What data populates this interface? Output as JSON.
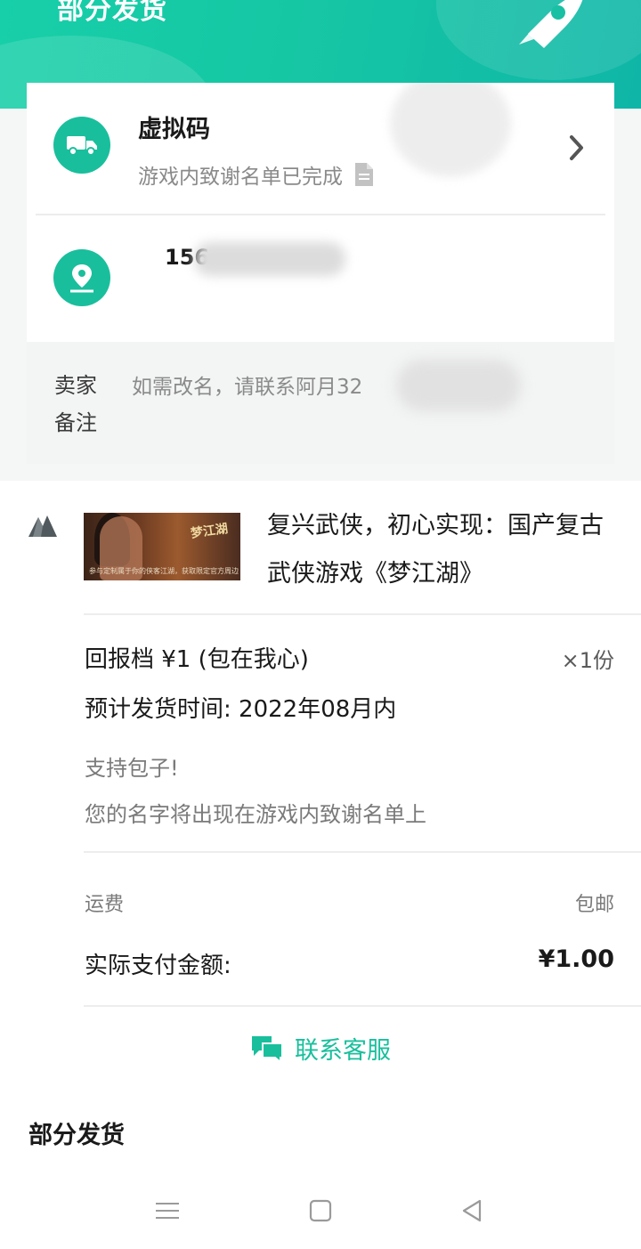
{
  "header": {
    "title": "部分发货"
  },
  "shipping": {
    "method_title": "虚拟码",
    "method_status": "游戏内致谢名单已完成"
  },
  "address": {
    "phone_prefix": "156"
  },
  "seller_note": {
    "label": "卖家备注",
    "text": "如需改名，请联系阿月32"
  },
  "product": {
    "title": "复兴武侠，初心实现：国产复古武侠游戏《梦江湖》",
    "image_logo": "梦江湖",
    "image_caption": "参与定制属于你的侠客江湖，获取限定官方周边",
    "tier": "回报档 ¥1 (包在我心)",
    "quantity": "×1份",
    "eta": "预计发货时间: 2022年08月内",
    "desc_line1": "支持包子!",
    "desc_line2": "您的名字将出现在游戏内致谢名单上"
  },
  "fees": {
    "shipping_label": "运费",
    "shipping_value": "包邮",
    "paid_label": "实际支付金额:",
    "paid_value": "¥1.00"
  },
  "contact": {
    "label": "联系客服"
  },
  "footer": {
    "status": "部分发货"
  },
  "colors": {
    "accent": "#19bf9c",
    "header_start": "#17cfa9",
    "header_end": "#0fb6a7"
  },
  "icons": [
    "rocket-icon",
    "truck-icon",
    "document-icon",
    "chevron-right-icon",
    "location-pin-icon",
    "shop-icon",
    "chat-bubbles-icon",
    "menu-icon",
    "square-icon",
    "back-triangle-icon"
  ]
}
